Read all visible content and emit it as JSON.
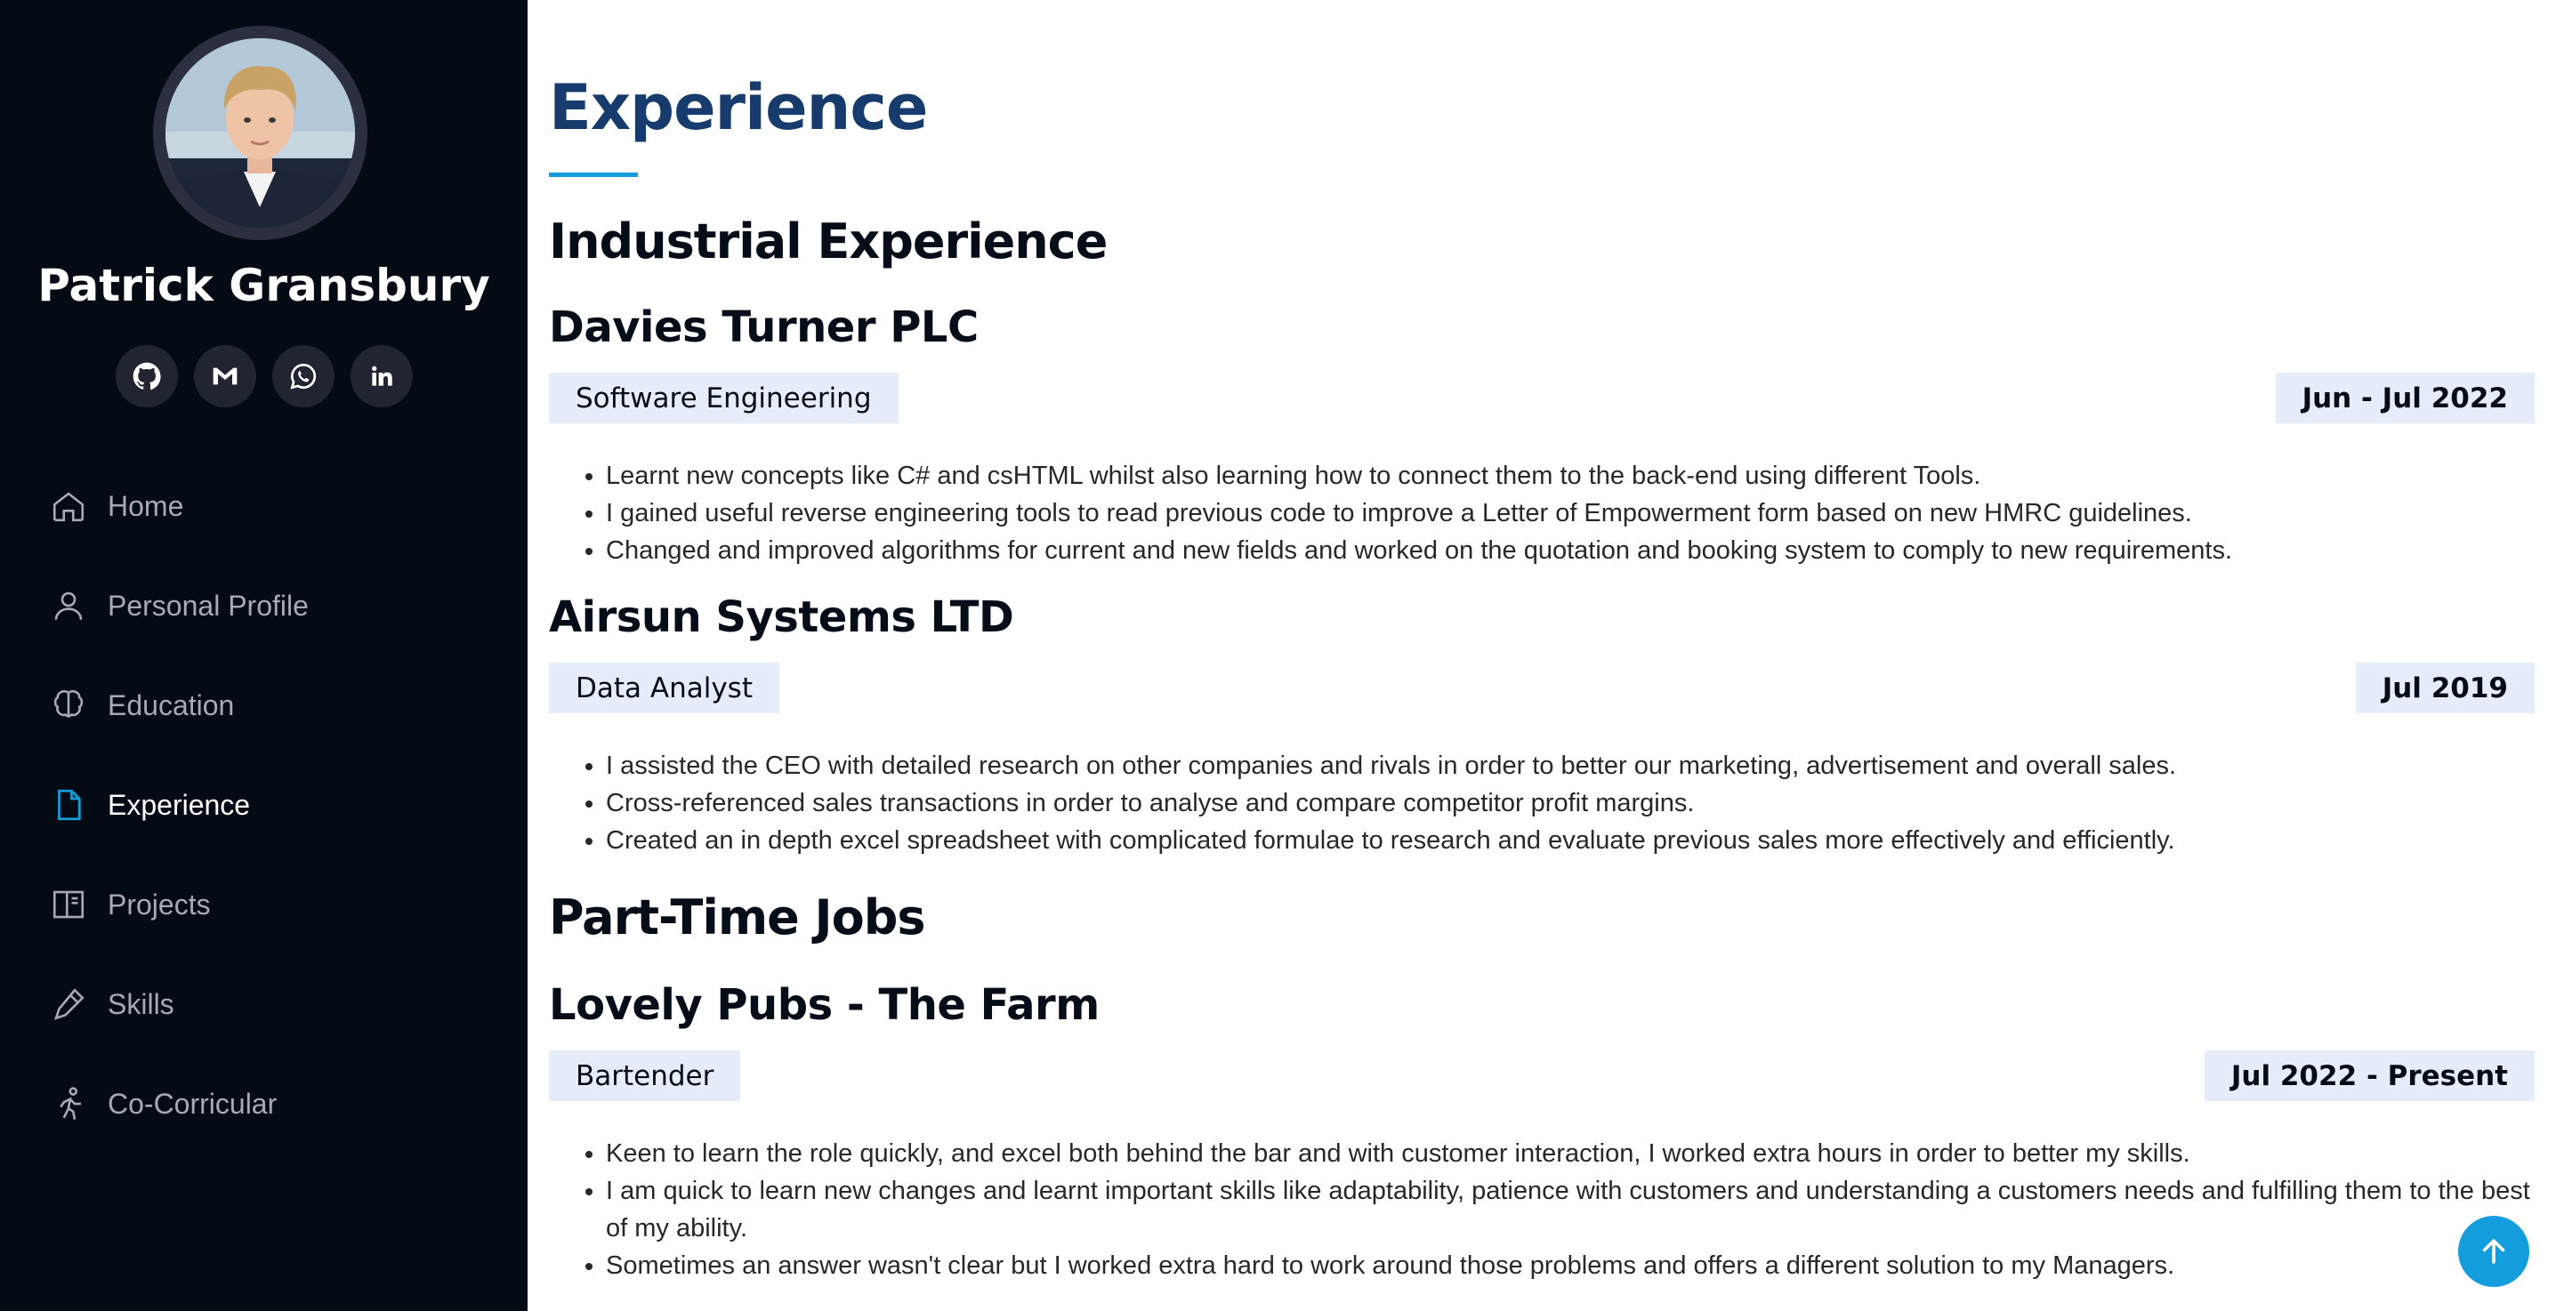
{
  "profile": {
    "name": "Patrick Gransbury",
    "social": [
      {
        "icon": "github-icon"
      },
      {
        "icon": "gmail-icon"
      },
      {
        "icon": "whatsapp-icon"
      },
      {
        "icon": "linkedin-icon"
      }
    ]
  },
  "nav": {
    "items": [
      {
        "label": "Home",
        "icon": "home-icon"
      },
      {
        "label": "Personal Profile",
        "icon": "person-icon"
      },
      {
        "label": "Education",
        "icon": "brain-icon"
      },
      {
        "label": "Experience",
        "icon": "file-icon",
        "active": true
      },
      {
        "label": "Projects",
        "icon": "book-icon"
      },
      {
        "label": "Skills",
        "icon": "pen-icon"
      },
      {
        "label": "Co-Corricular",
        "icon": "running-icon"
      }
    ]
  },
  "main": {
    "title": "Experience",
    "sections": {
      "industrial": "Industrial Experience",
      "parttime": "Part-Time Jobs"
    },
    "jobs": [
      {
        "company": "Davies Turner PLC",
        "role": "Software Engineering",
        "date": "Jun - Jul 2022",
        "bullets": [
          "Learnt new concepts like C# and csHTML whilst also learning how to connect them to the back-end using different Tools.",
          "I gained useful reverse engineering tools to read previous code to improve a Letter of Empowerment form based on new HMRC guidelines.",
          "Changed and improved algorithms for current and new fields and worked on the quotation and booking system to comply to new requirements."
        ]
      },
      {
        "company": "Airsun Systems LTD",
        "role": "Data Analyst",
        "date": "Jul 2019",
        "bullets": [
          "I assisted the CEO with detailed research on other companies and rivals in order to better our marketing, advertisement and overall sales.",
          "Cross-referenced sales transactions in order to analyse and compare competitor profit margins.",
          "Created an in depth excel spreadsheet with complicated formulae to research and evaluate previous sales more effectively and efficiently."
        ]
      },
      {
        "company": "Lovely Pubs - The Farm",
        "role": "Bartender",
        "date": "Jul 2022 - Present",
        "bullets": [
          "Keen to learn the role quickly, and excel both behind the bar and with customer interaction, I worked extra hours in order to better my skills.",
          "I am quick to learn new changes and learnt important skills like adaptability, patience with customers and understanding a customers needs and fulfilling them to the best of my ability.",
          "Sometimes an answer wasn't clear but I worked extra hard to work around those problems and offers a different solution to my Managers."
        ]
      }
    ]
  },
  "colors": {
    "sidebar_bg": "#040b14",
    "accent": "#149ddd",
    "title": "#173b6c",
    "tag_bg": "#e4edf9"
  },
  "back_to_top": {
    "icon": "arrow-up-icon"
  }
}
